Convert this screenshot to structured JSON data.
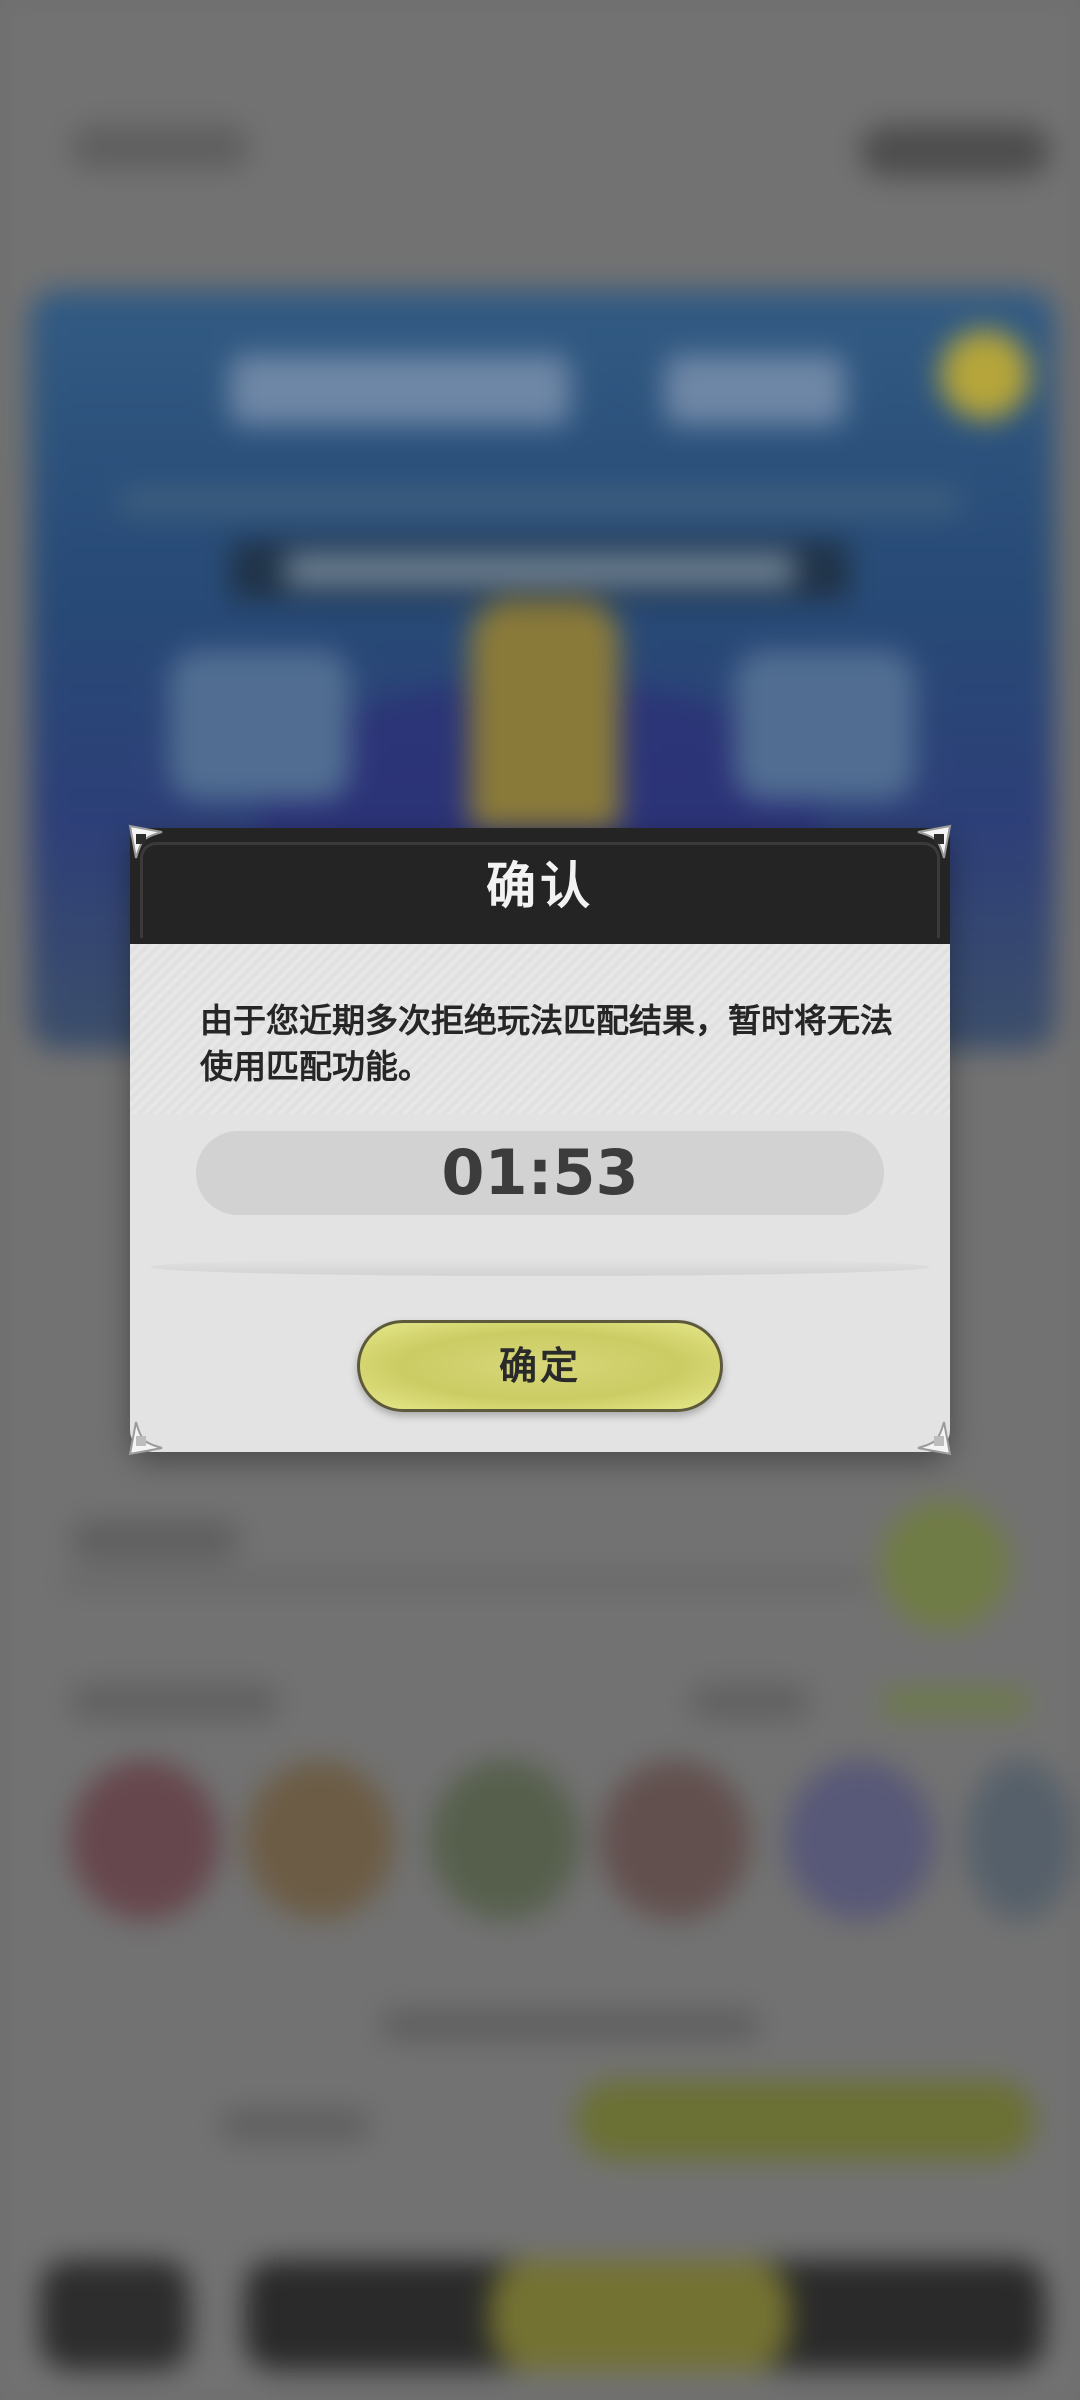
{
  "dialog": {
    "title": "确认",
    "message": "由于您近期多次拒绝玩法匹配结果，暂时将无法使用匹配功能。",
    "timer": "01:53",
    "confirm_label": "确定"
  },
  "colors": {
    "header_bg": "#242424",
    "dialog_bg": "#e3e3e3",
    "button_bg": "#cbcc63",
    "overlay": "#6e6e6e"
  }
}
